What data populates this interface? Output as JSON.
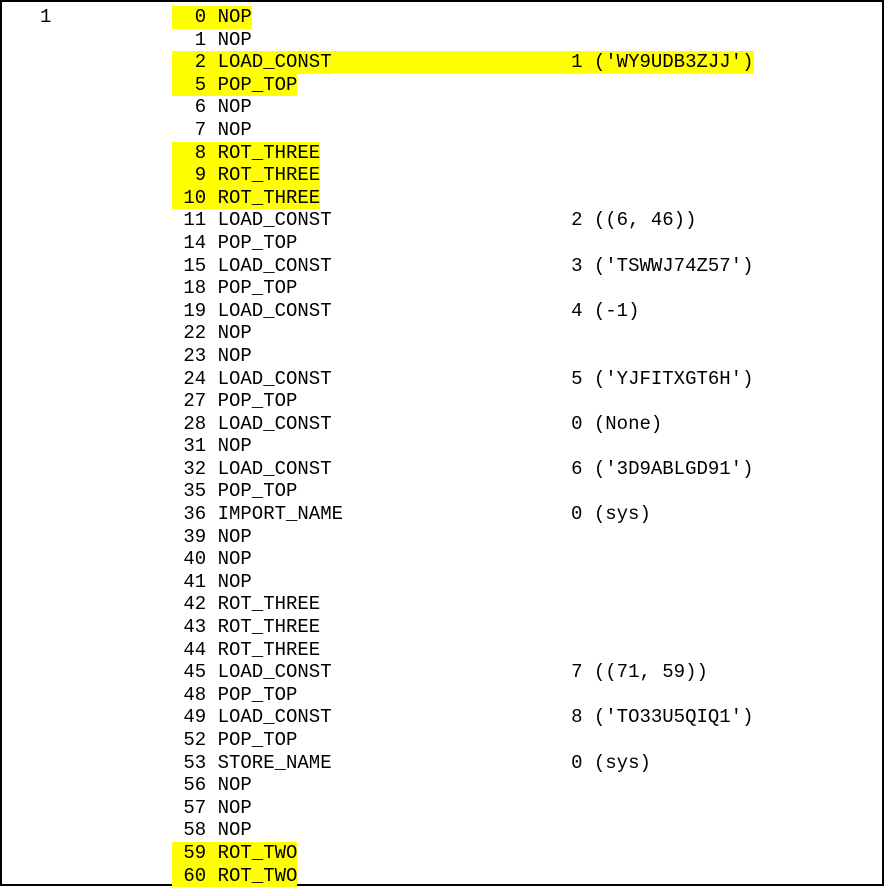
{
  "line_number": "1",
  "rows": [
    {
      "offset": "0",
      "op": "NOP",
      "idx": "",
      "arg": "",
      "hl": true
    },
    {
      "offset": "1",
      "op": "NOP",
      "idx": "",
      "arg": "",
      "hl": false
    },
    {
      "offset": "2",
      "op": "LOAD_CONST",
      "idx": "1",
      "arg": "('WY9UDB3ZJJ')",
      "hl": true
    },
    {
      "offset": "5",
      "op": "POP_TOP",
      "idx": "",
      "arg": "",
      "hl": true
    },
    {
      "offset": "6",
      "op": "NOP",
      "idx": "",
      "arg": "",
      "hl": false
    },
    {
      "offset": "7",
      "op": "NOP",
      "idx": "",
      "arg": "",
      "hl": false
    },
    {
      "offset": "8",
      "op": "ROT_THREE",
      "idx": "",
      "arg": "",
      "hl": true
    },
    {
      "offset": "9",
      "op": "ROT_THREE",
      "idx": "",
      "arg": "",
      "hl": true
    },
    {
      "offset": "10",
      "op": "ROT_THREE",
      "idx": "",
      "arg": "",
      "hl": true
    },
    {
      "offset": "11",
      "op": "LOAD_CONST",
      "idx": "2",
      "arg": "((6, 46))",
      "hl": false
    },
    {
      "offset": "14",
      "op": "POP_TOP",
      "idx": "",
      "arg": "",
      "hl": false
    },
    {
      "offset": "15",
      "op": "LOAD_CONST",
      "idx": "3",
      "arg": "('TSWWJ74Z57')",
      "hl": false
    },
    {
      "offset": "18",
      "op": "POP_TOP",
      "idx": "",
      "arg": "",
      "hl": false
    },
    {
      "offset": "19",
      "op": "LOAD_CONST",
      "idx": "4",
      "arg": "(-1)",
      "hl": false
    },
    {
      "offset": "22",
      "op": "NOP",
      "idx": "",
      "arg": "",
      "hl": false
    },
    {
      "offset": "23",
      "op": "NOP",
      "idx": "",
      "arg": "",
      "hl": false
    },
    {
      "offset": "24",
      "op": "LOAD_CONST",
      "idx": "5",
      "arg": "('YJFITXGT6H')",
      "hl": false
    },
    {
      "offset": "27",
      "op": "POP_TOP",
      "idx": "",
      "arg": "",
      "hl": false
    },
    {
      "offset": "28",
      "op": "LOAD_CONST",
      "idx": "0",
      "arg": "(None)",
      "hl": false
    },
    {
      "offset": "31",
      "op": "NOP",
      "idx": "",
      "arg": "",
      "hl": false
    },
    {
      "offset": "32",
      "op": "LOAD_CONST",
      "idx": "6",
      "arg": "('3D9ABLGD91')",
      "hl": false
    },
    {
      "offset": "35",
      "op": "POP_TOP",
      "idx": "",
      "arg": "",
      "hl": false
    },
    {
      "offset": "36",
      "op": "IMPORT_NAME",
      "idx": "0",
      "arg": "(sys)",
      "hl": false
    },
    {
      "offset": "39",
      "op": "NOP",
      "idx": "",
      "arg": "",
      "hl": false
    },
    {
      "offset": "40",
      "op": "NOP",
      "idx": "",
      "arg": "",
      "hl": false
    },
    {
      "offset": "41",
      "op": "NOP",
      "idx": "",
      "arg": "",
      "hl": false
    },
    {
      "offset": "42",
      "op": "ROT_THREE",
      "idx": "",
      "arg": "",
      "hl": false
    },
    {
      "offset": "43",
      "op": "ROT_THREE",
      "idx": "",
      "arg": "",
      "hl": false
    },
    {
      "offset": "44",
      "op": "ROT_THREE",
      "idx": "",
      "arg": "",
      "hl": false
    },
    {
      "offset": "45",
      "op": "LOAD_CONST",
      "idx": "7",
      "arg": "((71, 59))",
      "hl": false
    },
    {
      "offset": "48",
      "op": "POP_TOP",
      "idx": "",
      "arg": "",
      "hl": false
    },
    {
      "offset": "49",
      "op": "LOAD_CONST",
      "idx": "8",
      "arg": "('TO33U5QIQ1')",
      "hl": false
    },
    {
      "offset": "52",
      "op": "POP_TOP",
      "idx": "",
      "arg": "",
      "hl": false
    },
    {
      "offset": "53",
      "op": "STORE_NAME",
      "idx": "0",
      "arg": "(sys)",
      "hl": false
    },
    {
      "offset": "56",
      "op": "NOP",
      "idx": "",
      "arg": "",
      "hl": false
    },
    {
      "offset": "57",
      "op": "NOP",
      "idx": "",
      "arg": "",
      "hl": false
    },
    {
      "offset": "58",
      "op": "NOP",
      "idx": "",
      "arg": "",
      "hl": false
    },
    {
      "offset": "59",
      "op": "ROT_TWO",
      "idx": "",
      "arg": "",
      "hl": true
    },
    {
      "offset": "60",
      "op": "ROT_TWO",
      "idx": "",
      "arg": "",
      "hl": true
    }
  ]
}
